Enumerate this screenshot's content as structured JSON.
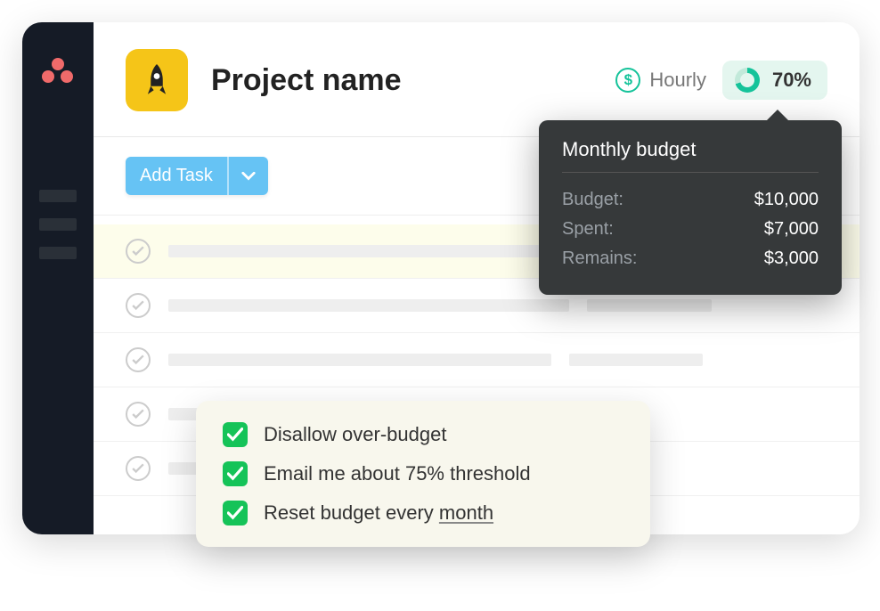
{
  "header": {
    "title": "Project name",
    "billing_type": "Hourly",
    "progress_pct": "70%"
  },
  "toolbar": {
    "add_task_label": "Add Task"
  },
  "popover": {
    "title": "Monthly budget",
    "rows": [
      {
        "label": "Budget:",
        "value": "$10,000"
      },
      {
        "label": "Spent:",
        "value": "$7,000"
      },
      {
        "label": "Remains:",
        "value": "$3,000"
      }
    ]
  },
  "settings": {
    "items": [
      {
        "text": "Disallow over-budget"
      },
      {
        "text": "Email me about 75% threshold"
      },
      {
        "text_prefix": "Reset budget every ",
        "underline": "month"
      }
    ]
  },
  "icons": {
    "dollar": "$"
  }
}
